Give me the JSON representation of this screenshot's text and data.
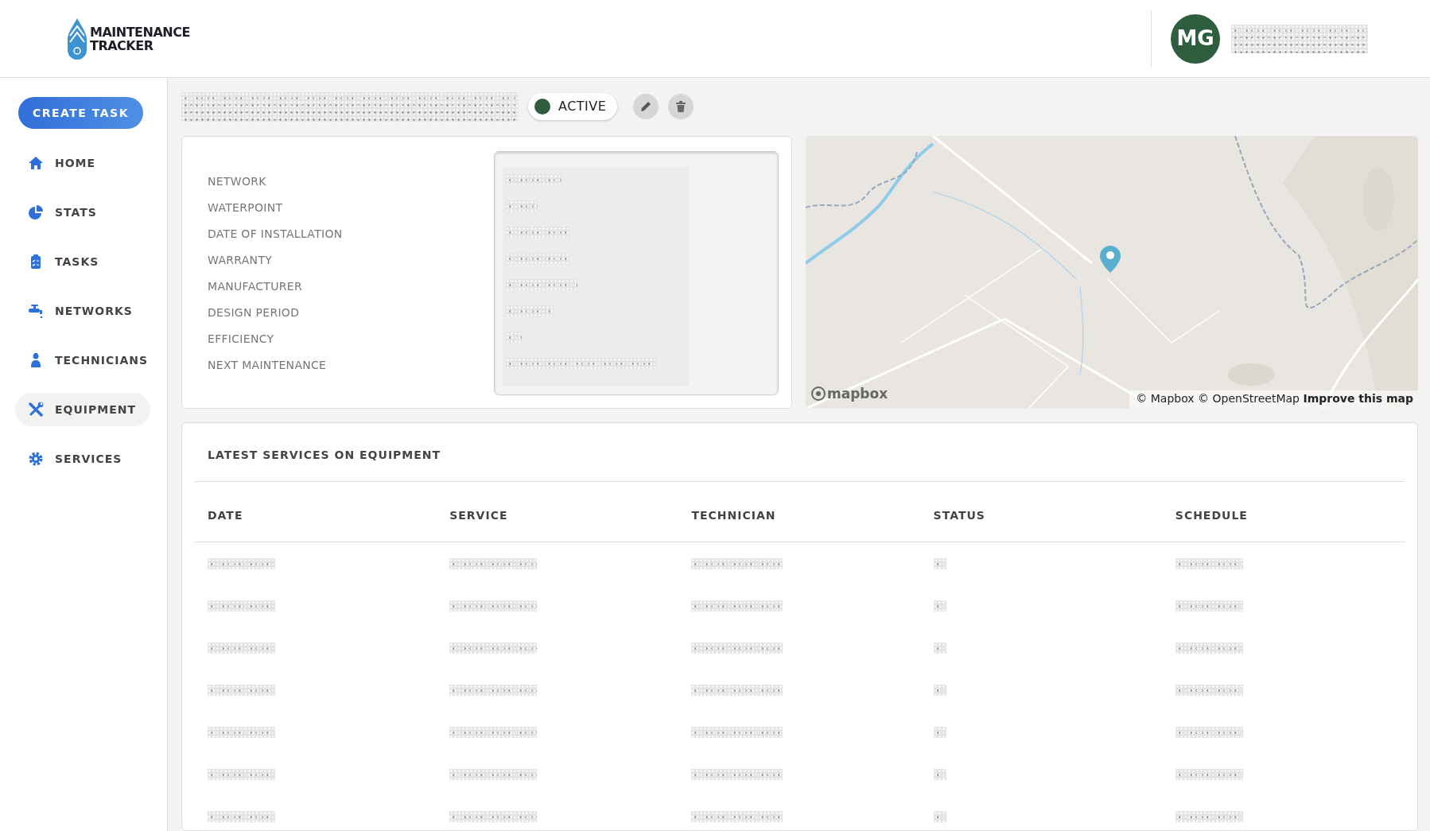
{
  "header": {
    "logo_lines": [
      "MAINTENANCE",
      "TRACKER"
    ],
    "avatar_initials": "MG",
    "user_name": {
      "redacted": true
    }
  },
  "sidebar": {
    "create_button": "CREATE TASK",
    "items": [
      {
        "label": "HOME",
        "selected": false
      },
      {
        "label": "STATS",
        "selected": false
      },
      {
        "label": "TASKS",
        "selected": false
      },
      {
        "label": "NETWORKS",
        "selected": false
      },
      {
        "label": "TECHNICIANS",
        "selected": false
      },
      {
        "label": "EQUIPMENT",
        "selected": true
      },
      {
        "label": "SERVICES",
        "selected": false
      }
    ]
  },
  "equipment": {
    "title": {
      "redacted": true
    },
    "status": {
      "label": "ACTIVE",
      "color": "#2e5e3e"
    }
  },
  "details": [
    {
      "label": "NETWORK",
      "redacted": true
    },
    {
      "label": "WATERPOINT",
      "redacted": true
    },
    {
      "label": "DATE OF INSTALLATION",
      "redacted": true
    },
    {
      "label": "WARRANTY",
      "redacted": true
    },
    {
      "label": "MANUFACTURER",
      "redacted": true
    },
    {
      "label": "DESIGN PERIOD",
      "redacted": true
    },
    {
      "label": "EFFICIENCY",
      "redacted": true
    },
    {
      "label": "NEXT MAINTENANCE",
      "redacted": true
    }
  ],
  "map": {
    "kind": "picture",
    "logo_text": "mapbox",
    "attribution": "© Mapbox © OpenStreetMap",
    "improve_link": "Improve this map"
  },
  "services": {
    "heading": "LATEST SERVICES ON EQUIPMENT",
    "columns": [
      {
        "label": "DATE"
      },
      {
        "label": "SERVICE"
      },
      {
        "label": "TECHNICIAN"
      },
      {
        "label": "STATUS"
      },
      {
        "label": "SCHEDULE"
      }
    ],
    "rows": [
      {
        "redacted": true
      },
      {
        "redacted": true
      },
      {
        "redacted": true
      },
      {
        "redacted": true
      },
      {
        "redacted": true
      },
      {
        "redacted": true
      },
      {
        "redacted": true
      }
    ]
  }
}
